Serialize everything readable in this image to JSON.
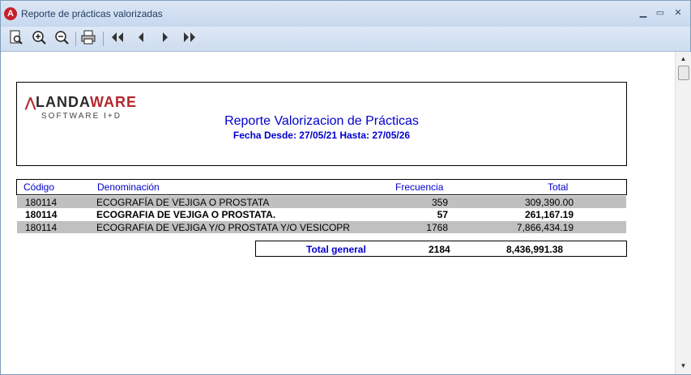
{
  "window": {
    "title": "Reporte de prácticas valorizadas",
    "app_icon_letter": "A"
  },
  "toolbar": {
    "buttons": [
      "preview-icon",
      "zoom-in-icon",
      "zoom-out-icon",
      "print-icon",
      "first-page-icon",
      "previous-page-icon",
      "next-page-icon",
      "last-page-icon"
    ]
  },
  "report": {
    "logo": {
      "mark": "⋀",
      "land": "LANDA",
      "ware": "WARE",
      "sub": "SOFTWARE I+D"
    },
    "title": "Reporte Valorizacion de Prácticas",
    "subtitle": "Fecha Desde: 27/05/21 Hasta: 27/05/26",
    "columns": {
      "code": "Código",
      "name": "Denominación",
      "freq": "Frecuencia",
      "total": "Total"
    },
    "rows": [
      {
        "code": "180114",
        "name": "ECOGRAFÍA DE VEJIGA O PROSTATA",
        "freq": "359",
        "total": "309,390.00"
      },
      {
        "code": "180114",
        "name": "ECOGRAFIA DE VEJIGA O PROSTATA.",
        "freq": "57",
        "total": "261,167.19"
      },
      {
        "code": "180114",
        "name": "ECOGRAFIA DE VEJIGA Y/O PROSTATA Y/O VESICOPR",
        "freq": "1768",
        "total": "7,866,434.19"
      }
    ],
    "total_general": {
      "label": "Total general",
      "freq": "2184",
      "total": "8,436,991.38"
    }
  },
  "colors": {
    "accent": "#0000cc",
    "brand": "#b3282d",
    "shade": "#c0c0c0"
  }
}
